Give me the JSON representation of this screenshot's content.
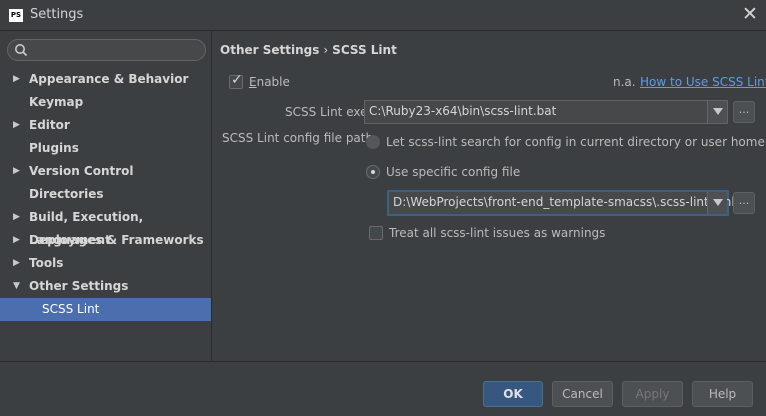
{
  "window": {
    "icon_text": "PS",
    "title": "Settings"
  },
  "sidebar": {
    "search_placeholder": "",
    "items": [
      {
        "label": "Appearance & Behavior",
        "arrow": "▶"
      },
      {
        "label": "Keymap",
        "arrow": ""
      },
      {
        "label": "Editor",
        "arrow": "▶"
      },
      {
        "label": "Plugins",
        "arrow": ""
      },
      {
        "label": "Version Control",
        "arrow": "▶"
      },
      {
        "label": "Directories",
        "arrow": ""
      },
      {
        "label": "Build, Execution, Deployment",
        "arrow": "▶"
      },
      {
        "label": "Languages & Frameworks",
        "arrow": "▶"
      },
      {
        "label": "Tools",
        "arrow": "▶"
      },
      {
        "label": "Other Settings",
        "arrow": "▼"
      },
      {
        "label": "SCSS Lint",
        "arrow": ""
      }
    ]
  },
  "breadcrumb": {
    "parent": "Other Settings",
    "separator": "›",
    "current": "SCSS Lint"
  },
  "content": {
    "enable_label_mnemonic": "E",
    "enable_label_rest": "nable",
    "enable_checked": true,
    "version_text": "n.a.",
    "help_link": "How to Use SCSS Lint",
    "exe_label": "SCSS Lint exe",
    "exe_value": "C:\\Ruby23-x64\\bin\\scss-lint.bat",
    "config_label": "SCSS Lint config file path",
    "radio_search_label": "Let scss-lint search for config in current directory or user home",
    "radio_specific_label": "Use specific config file",
    "selected_radio": "specific",
    "config_value": "D:\\WebProjects\\front-end_template-smacss\\.scss-lint.yml",
    "warnings_label": "Treat all scss-lint issues as warnings",
    "warnings_checked": false,
    "browse_label": "...",
    "accent_color": "#4b6eaf"
  },
  "footer": {
    "ok": "OK",
    "cancel": "Cancel",
    "apply": "Apply",
    "help": "Help"
  }
}
